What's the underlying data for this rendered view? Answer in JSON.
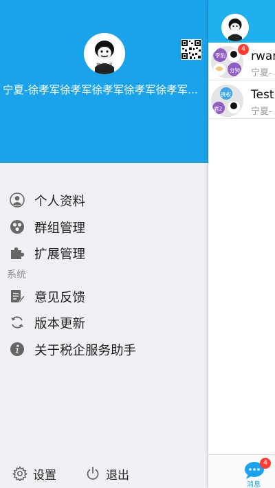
{
  "drawer": {
    "username": "宁夏-徐孝军徐孝军徐孝军徐孝军徐孝军...",
    "avatar_caption": "笑成小逗",
    "menu": [
      {
        "label": "个人资料",
        "icon": "person-icon"
      },
      {
        "label": "群组管理",
        "icon": "group-icon"
      },
      {
        "label": "扩展管理",
        "icon": "puzzle-icon"
      }
    ],
    "section_system": "系统",
    "system_menu": [
      {
        "label": "意见反馈",
        "icon": "feedback-icon"
      },
      {
        "label": "版本更新",
        "icon": "refresh-icon"
      },
      {
        "label": "关于税企服务助手",
        "icon": "info-icon"
      }
    ],
    "footer": {
      "settings": "设置",
      "logout": "退出"
    }
  },
  "main": {
    "chats": [
      {
        "title": "rwan",
        "subtitle": "宁夏-",
        "badge": "4",
        "avatar_tags": [
          "李豹",
          "分钟"
        ]
      },
      {
        "title": "Test",
        "subtitle": "宁夏-",
        "avatar_tags": [
          "贵权",
          "君2"
        ]
      }
    ],
    "tab": {
      "label": "消息",
      "badge": "4"
    }
  },
  "colors": {
    "header_blue": "#1aa2ea",
    "drawer_bg": "#efeff4",
    "badge_red": "#ff3b30"
  }
}
